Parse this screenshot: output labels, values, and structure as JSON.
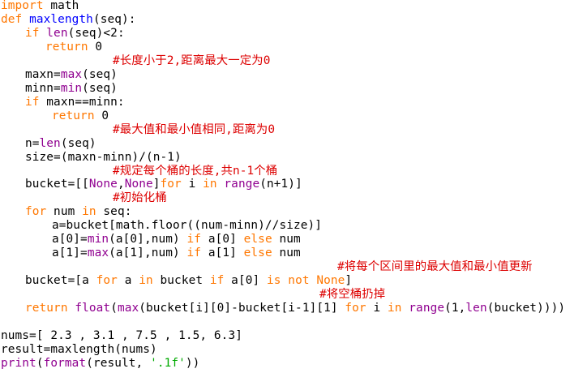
{
  "editor": {
    "colors": {
      "keyword": "#ff7700",
      "builtin": "#900090",
      "function_name": "#0000ff",
      "comment": "#dd0000",
      "string": "#00aa00",
      "default": "#000000"
    },
    "lines": [
      [
        [
          "k",
          "import"
        ],
        [
          "n",
          " math"
        ]
      ],
      [
        [
          "k",
          "def"
        ],
        [
          "n",
          " "
        ],
        [
          "f",
          "maxlength"
        ],
        [
          "n",
          "(seq):"
        ]
      ],
      [
        [
          "k",
          "if"
        ],
        [
          "n",
          " "
        ],
        [
          "b",
          "len"
        ],
        [
          "n",
          "(seq)<2:"
        ]
      ],
      [
        [
          "k",
          "return"
        ],
        [
          "n",
          " 0"
        ]
      ],
      [
        [
          "c",
          "#长度小于2,距离最大一定为0"
        ]
      ],
      [
        [
          "n",
          "maxn="
        ],
        [
          "b",
          "max"
        ],
        [
          "n",
          "(seq)"
        ]
      ],
      [
        [
          "n",
          "minn="
        ],
        [
          "b",
          "min"
        ],
        [
          "n",
          "(seq)"
        ]
      ],
      [
        [
          "k",
          "if"
        ],
        [
          "n",
          " maxn==minn:"
        ]
      ],
      [
        [
          "k",
          "return"
        ],
        [
          "n",
          " 0"
        ]
      ],
      [
        [
          "c",
          "#最大值和最小值相同,距离为0"
        ]
      ],
      [
        [
          "n",
          "n="
        ],
        [
          "b",
          "len"
        ],
        [
          "n",
          "(seq)"
        ]
      ],
      [
        [
          "n",
          "size=(maxn-minn)/(n-1)"
        ]
      ],
      [
        [
          "c",
          "#规定每个桶的长度,共n-1个桶"
        ]
      ],
      [
        [
          "n",
          "bucket=[["
        ],
        [
          "b",
          "None"
        ],
        [
          "n",
          ","
        ],
        [
          "b",
          "None"
        ],
        [
          "n",
          "]"
        ],
        [
          "k",
          "for"
        ],
        [
          "n",
          " i "
        ],
        [
          "k",
          "in"
        ],
        [
          "n",
          " "
        ],
        [
          "b",
          "range"
        ],
        [
          "n",
          "(n+1)]"
        ]
      ],
      [
        [
          "c",
          "#初始化桶"
        ]
      ],
      [
        [
          "k",
          "for"
        ],
        [
          "n",
          " num "
        ],
        [
          "k",
          "in"
        ],
        [
          "n",
          " seq:"
        ]
      ],
      [
        [
          "n",
          "a=bucket[math.floor((num-minn)//size)]"
        ]
      ],
      [
        [
          "n",
          "a[0]="
        ],
        [
          "b",
          "min"
        ],
        [
          "n",
          "(a[0],num) "
        ],
        [
          "k",
          "if"
        ],
        [
          "n",
          " a[0] "
        ],
        [
          "k",
          "else"
        ],
        [
          "n",
          " num"
        ]
      ],
      [
        [
          "n",
          "a[1]="
        ],
        [
          "b",
          "max"
        ],
        [
          "n",
          "(a[1],num) "
        ],
        [
          "k",
          "if"
        ],
        [
          "n",
          " a[1] "
        ],
        [
          "k",
          "else"
        ],
        [
          "n",
          " num"
        ]
      ],
      [
        [
          "c",
          "#将每个区间里的最大值和最小值更新"
        ]
      ],
      [
        [
          "n",
          "bucket=[a "
        ],
        [
          "k",
          "for"
        ],
        [
          "n",
          " a "
        ],
        [
          "k",
          "in"
        ],
        [
          "n",
          " bucket "
        ],
        [
          "k",
          "if"
        ],
        [
          "n",
          " a[0] "
        ],
        [
          "k",
          "is not None"
        ],
        [
          "n",
          "]"
        ]
      ],
      [
        [
          "c",
          "#将空桶扔掉"
        ]
      ],
      [
        [
          "k",
          "return"
        ],
        [
          "n",
          " "
        ],
        [
          "b",
          "float"
        ],
        [
          "n",
          "("
        ],
        [
          "b",
          "max"
        ],
        [
          "n",
          "(bucket[i][0]-bucket[i-1][1] "
        ],
        [
          "k",
          "for"
        ],
        [
          "n",
          " i "
        ],
        [
          "k",
          "in"
        ],
        [
          "n",
          " "
        ],
        [
          "b",
          "range"
        ],
        [
          "n",
          "(1,"
        ],
        [
          "b",
          "len"
        ],
        [
          "n",
          "(bucket))))"
        ]
      ],
      [],
      [
        [
          "n",
          "nums=[ 2.3 , 3.1 , 7.5 , 1.5, 6.3]"
        ]
      ],
      [
        [
          "n",
          "result=maxlength(nums)"
        ]
      ],
      [
        [
          "b",
          "print"
        ],
        [
          "n",
          "("
        ],
        [
          "b",
          "format"
        ],
        [
          "n",
          "(result, "
        ],
        [
          "s",
          "'.1f'"
        ],
        [
          "n",
          "))"
        ]
      ]
    ]
  }
}
